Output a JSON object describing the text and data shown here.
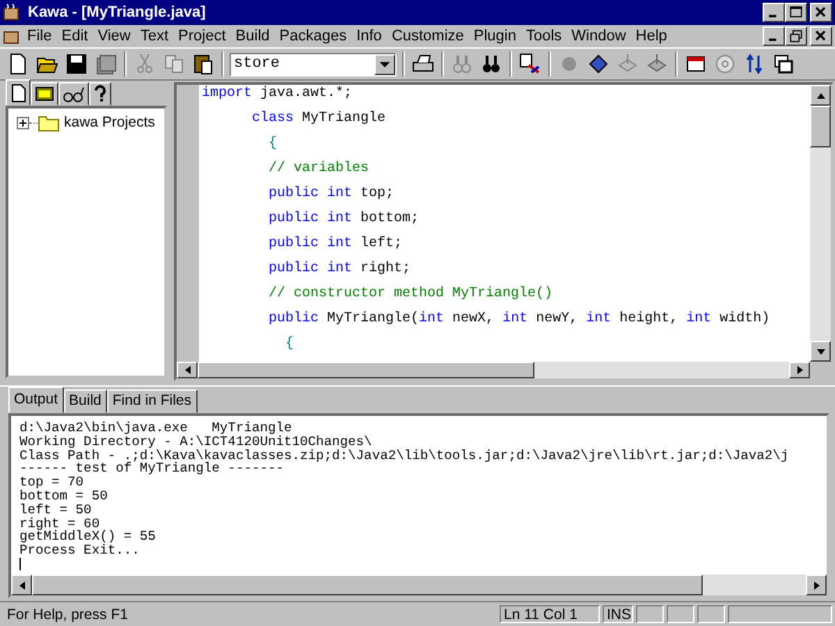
{
  "window": {
    "title": "Kawa - [MyTriangle.java]"
  },
  "menu": [
    "File",
    "Edit",
    "View",
    "Text",
    "Project",
    "Build",
    "Packages",
    "Info",
    "Customize",
    "Plugin",
    "Tools",
    "Window",
    "Help"
  ],
  "toolbar": {
    "combo": {
      "value": "store"
    }
  },
  "project_panel": {
    "tabs": [
      {
        "kind": "file",
        "selected": true
      },
      {
        "kind": "classes",
        "selected": false
      },
      {
        "kind": "glasses",
        "selected": false
      },
      {
        "kind": "help",
        "selected": false
      }
    ],
    "tree": [
      {
        "label": "kawa Projects",
        "expanded": false
      }
    ]
  },
  "editor": {
    "lines": [
      [
        {
          "kind": "keyword",
          "text": "import"
        },
        {
          "kind": "plain",
          "text": " java.awt.*;"
        }
      ],
      [
        {
          "kind": "keyword",
          "text": "      class"
        },
        {
          "kind": "plain",
          "text": " MyTriangle"
        }
      ],
      [
        {
          "kind": "brace",
          "text": "        {"
        }
      ],
      [
        {
          "kind": "comment",
          "text": "        // variables"
        }
      ],
      [
        {
          "kind": "keyword",
          "text": "        public int"
        },
        {
          "kind": "plain",
          "text": " top;"
        }
      ],
      [
        {
          "kind": "keyword",
          "text": "        public int"
        },
        {
          "kind": "plain",
          "text": " bottom;"
        }
      ],
      [
        {
          "kind": "keyword",
          "text": "        public int"
        },
        {
          "kind": "plain",
          "text": " left;"
        }
      ],
      [
        {
          "kind": "keyword",
          "text": "        public int"
        },
        {
          "kind": "plain",
          "text": " right;"
        }
      ],
      [
        {
          "kind": "comment",
          "text": "        // constructor method MyTriangle()"
        }
      ],
      [
        {
          "kind": "keyword",
          "text": "        public"
        },
        {
          "kind": "plain",
          "text": " MyTriangle("
        },
        {
          "kind": "keyword",
          "text": "int"
        },
        {
          "kind": "plain",
          "text": " newX, "
        },
        {
          "kind": "keyword",
          "text": "int"
        },
        {
          "kind": "plain",
          "text": " newY, "
        },
        {
          "kind": "keyword",
          "text": "int"
        },
        {
          "kind": "plain",
          "text": " height, "
        },
        {
          "kind": "keyword",
          "text": "int"
        },
        {
          "kind": "plain",
          "text": " width)"
        }
      ],
      [
        {
          "kind": "brace",
          "text": "          {"
        }
      ]
    ]
  },
  "output": {
    "tabs": [
      {
        "label": "Output",
        "selected": true
      },
      {
        "label": "Build",
        "selected": false
      },
      {
        "label": "Find in Files",
        "selected": false
      }
    ],
    "lines": [
      "d:\\Java2\\bin\\java.exe   MyTriangle",
      "Working Directory - A:\\ICT4120Unit10Changes\\",
      "Class Path - .;d:\\Kava\\kavaclasses.zip;d:\\Java2\\lib\\tools.jar;d:\\Java2\\jre\\lib\\rt.jar;d:\\Java2\\j",
      "------ test of MyTriangle -------",
      "top = 70",
      "bottom = 50",
      "left = 50",
      "right = 60",
      "getMiddleX() = 55",
      "Process Exit..."
    ]
  },
  "status_bar": {
    "help": "For Help, press F1",
    "position": "Ln 11 Col 1",
    "mode": "INS"
  }
}
